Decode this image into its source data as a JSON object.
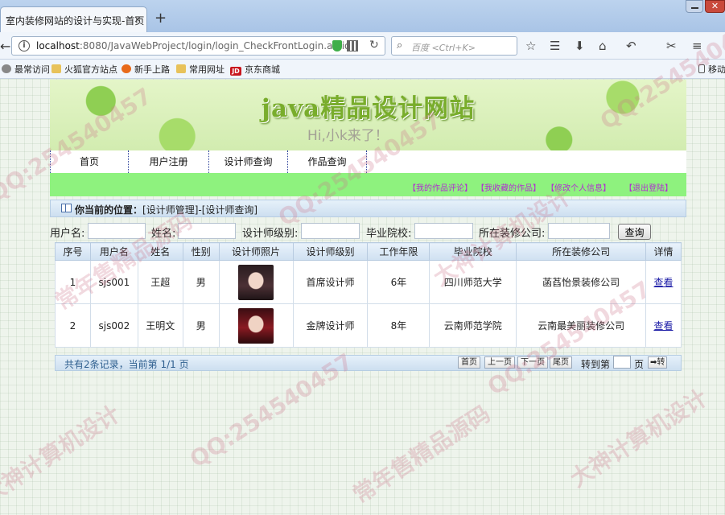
{
  "browser": {
    "tab_title": "室内装修网站的设计与实现-首页",
    "tab_close": "×",
    "new_tab": "+",
    "win_close": "✕",
    "url_host": "localhost",
    "url_path": ":8080/JavaWebProject/login/login_CheckFrontLogin.action",
    "search_placeholder": "百度 <Ctrl+K>",
    "bookmarks": [
      "最常访问",
      "火狐官方站点",
      "新手上路",
      "常用网址",
      "京东商城",
      "移动"
    ]
  },
  "site": {
    "title": "java精品设计网站",
    "subtitle": "Hi,小k来了！",
    "menu": [
      "首页",
      "用户注册",
      "设计师查询",
      "作品查询"
    ],
    "user_links": [
      "【我的作品评论】",
      "【我收藏的作品】",
      "【修改个人信息】",
      "【退出登陆】"
    ],
    "location_label": "你当前的位置：",
    "location_path": "[设计师管理]-[设计师查询]"
  },
  "filter": {
    "username_label": "用户名:",
    "name_label": "姓名:",
    "level_label": "设计师级别:",
    "school_label": "毕业院校:",
    "company_label": "所在装修公司:",
    "query_button": "查询"
  },
  "table": {
    "headers": [
      "序号",
      "用户名",
      "姓名",
      "性别",
      "设计师照片",
      "设计师级别",
      "工作年限",
      "毕业院校",
      "所在装修公司",
      "详情"
    ],
    "rows": [
      {
        "no": "1",
        "username": "sjs001",
        "name": "王超",
        "gender": "男",
        "level": "首席设计师",
        "years": "6年",
        "school": "四川师范大学",
        "company": "菡萏怡景装修公司",
        "detail": "查看"
      },
      {
        "no": "2",
        "username": "sjs002",
        "name": "王明文",
        "gender": "男",
        "level": "金牌设计师",
        "years": "8年",
        "school": "云南师范学院",
        "company": "云南最美丽装修公司",
        "detail": "查看"
      }
    ]
  },
  "pager": {
    "info": "共有2条记录，当前第 1/1 页",
    "first": "首页",
    "prev": "上一页",
    "next": "下一页",
    "last": "尾页",
    "goto_label": "转到第",
    "goto_unit": "页",
    "go_button": "➡转"
  },
  "watermarks": [
    "QQ:254540457",
    "常年售精品源码",
    "大神计算机设计"
  ]
}
